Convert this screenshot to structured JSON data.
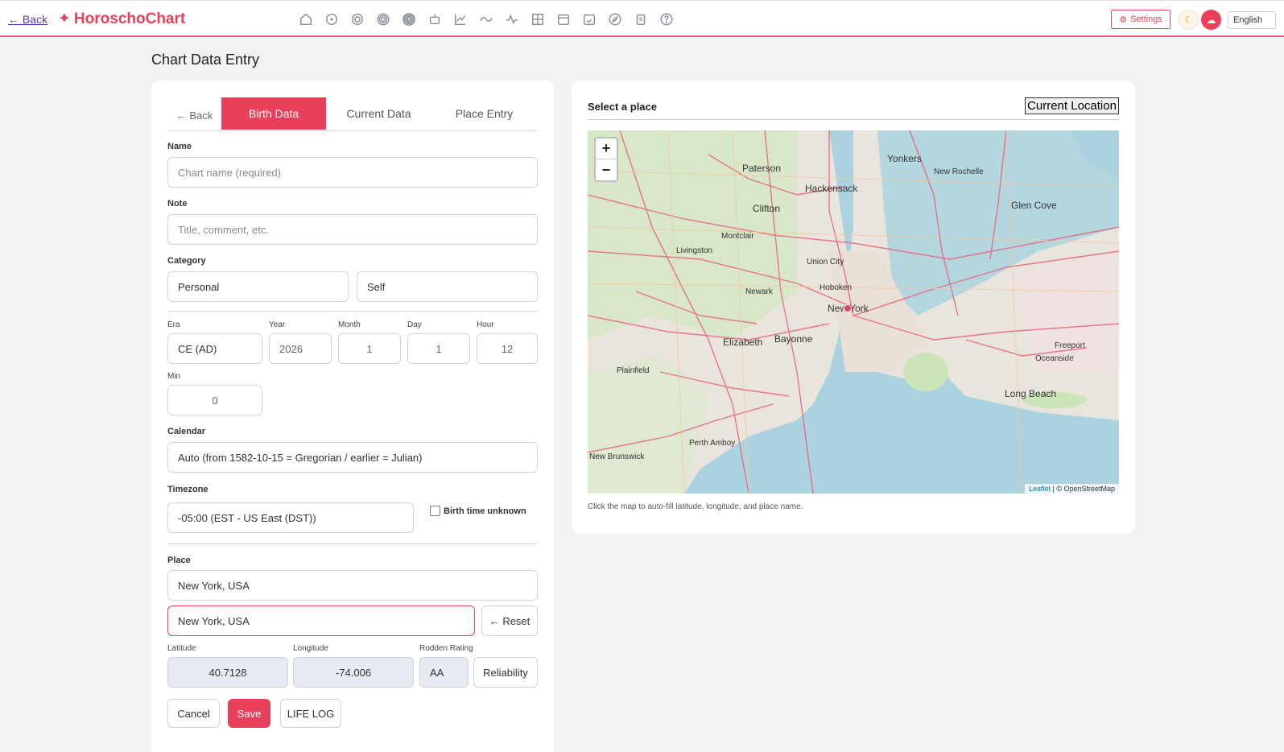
{
  "topbar": {
    "back_label": "← Back",
    "brand_star": "✦",
    "brand_name": "HoroschoChart",
    "icons": [
      "home-icon",
      "circle-dot-icon",
      "target-icon",
      "concentric-icon",
      "spiral-icon",
      "robot-icon",
      "line-chart-icon",
      "wave-icon",
      "pulse-icon",
      "grid-icon",
      "calendar-icon",
      "calendar-check-icon",
      "compass-icon",
      "clipboard-icon",
      "help-icon"
    ],
    "settings_label": "Settings",
    "language": "English"
  },
  "page_title": "Chart Data Entry",
  "tabs": {
    "back": "← Back",
    "birth": "Birth Data",
    "current": "Current Data",
    "place": "Place Entry"
  },
  "form": {
    "name_label": "Name",
    "name_placeholder": "Chart name (required)",
    "note_label": "Note",
    "note_placeholder": "Title, comment, etc.",
    "category_label": "Category",
    "category_1": "Personal",
    "category_2": "Self",
    "era_label": "Era",
    "era_value": "CE (AD)",
    "year_label": "Year",
    "year_value": "2026",
    "month_label": "Month",
    "month_value": "1",
    "day_label": "Day",
    "day_value": "1",
    "hour_label": "Hour",
    "hour_value": "12",
    "min_label": "Min",
    "min_value": "0",
    "calendar_label": "Calendar",
    "calendar_value": "Auto (from 1582-10-15 = Gregorian / earlier = Julian)",
    "timezone_label": "Timezone",
    "timezone_value": "-05:00 (EST - US East (DST))",
    "birth_unknown_label": "Birth time unknown",
    "place_label": "Place",
    "place_value": "New York, USA",
    "place_search_value": "New York, USA",
    "reset_label": "← Reset",
    "latitude_label": "Latitude",
    "latitude_value": "40.7128",
    "longitude_label": "Longitude",
    "longitude_value": "-74.006",
    "rodden_label": "Rodden Rating",
    "rodden_value": "AA",
    "reliability_label": "Reliability",
    "cancel_label": "Cancel",
    "save_label": "Save",
    "lifelog_label": "LIFE LOG"
  },
  "map": {
    "title": "Select a place",
    "current_location": "Current Location",
    "zoom_in": "+",
    "zoom_out": "−",
    "attribution_leaflet": "Leaflet",
    "attribution_rest": " | © OpenStreetMap",
    "hint": "Click the map to auto-fill latitude, longitude, and place name.",
    "labels": [
      "Paterson",
      "Hackensack",
      "Yonkers",
      "New Rochelle",
      "Clifton",
      "Glen Cove",
      "Newark",
      "New York",
      "Elizabeth",
      "Bayonne",
      "Long Beach",
      "New Brunswick",
      "Livingston",
      "Union City",
      "Hoboken",
      "Oceanside",
      "Freeport",
      "Montclair",
      "Plainfield",
      "Perth Amboy"
    ]
  }
}
